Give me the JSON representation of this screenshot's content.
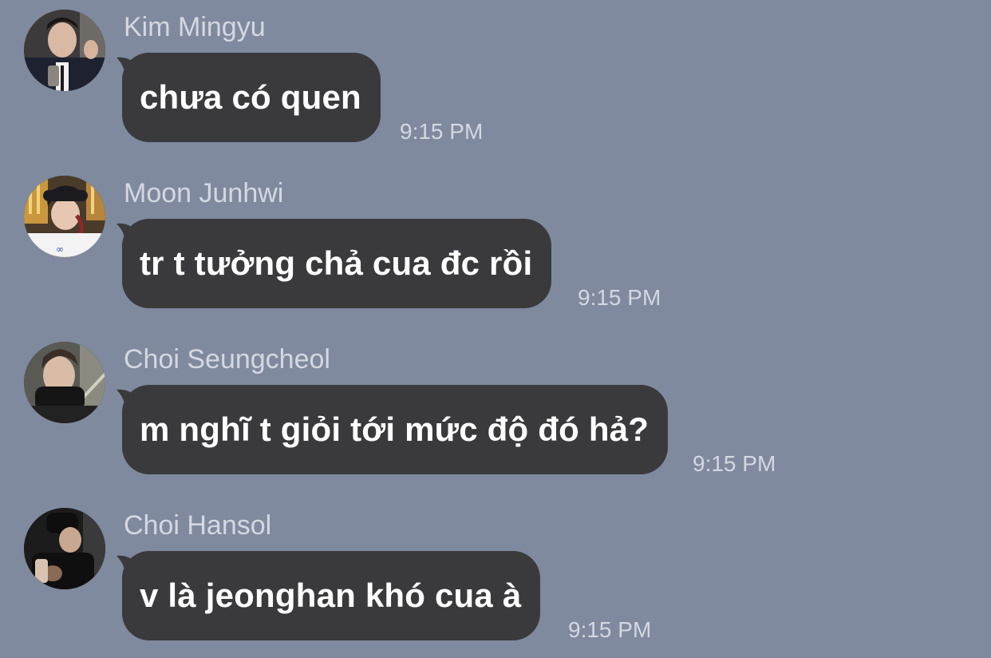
{
  "messages": [
    {
      "sender": "Kim Mingyu",
      "text": "chưa có quen",
      "time": "9:15 PM",
      "avatar": "kim-mingyu-avatar"
    },
    {
      "sender": "Moon Junhwi",
      "text": "tr t tưởng chả cua đc rồi",
      "time": "9:15 PM",
      "avatar": "moon-junhwi-avatar"
    },
    {
      "sender": "Choi Seungcheol",
      "text": "m nghĩ t giỏi tới mức độ đó hả?",
      "time": "9:15 PM",
      "avatar": "choi-seungcheol-avatar"
    },
    {
      "sender": "Choi Hansol",
      "text": "v là jeonghan khó cua à",
      "time": "9:15 PM",
      "avatar": "choi-hansol-avatar"
    }
  ],
  "colors": {
    "background": "#7f8a9f",
    "bubble": "#3a3a3c",
    "bubble_text": "#ffffff",
    "meta_text": "#d3d8e2"
  }
}
